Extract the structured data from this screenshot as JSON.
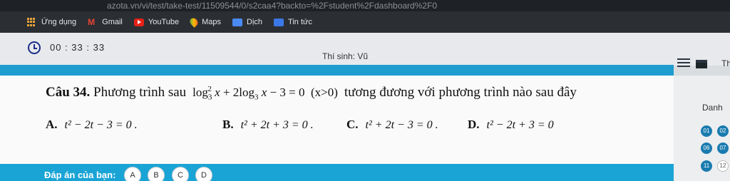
{
  "browser": {
    "url": "azota.vn/vi/test/take-test/11509544/0/s2caa4?backto=%2Fstudent%2Fdashboard%2F0",
    "bookmarks": [
      {
        "label": "Ứng dụng",
        "icon": "apps-icon"
      },
      {
        "label": "Gmail",
        "icon": "gmail-icon"
      },
      {
        "label": "YouTube",
        "icon": "youtube-icon"
      },
      {
        "label": "Maps",
        "icon": "maps-icon"
      },
      {
        "label": "Dịch",
        "icon": "translate-icon"
      },
      {
        "label": "Tin tức",
        "icon": "news-icon"
      }
    ]
  },
  "exam": {
    "timer": "00 : 33 : 33",
    "student": "Thí sinh: Vũ",
    "right_header": "Th"
  },
  "question": {
    "number": "Câu 34.",
    "prefix": "Phương trình sau",
    "suffix": "tương đương với phương trình nào sau đây",
    "answers": [
      {
        "letter": "A.",
        "text": "t² − 2t − 3 = 0 ."
      },
      {
        "letter": "B.",
        "text": "t² + 2t + 3 = 0 ."
      },
      {
        "letter": "C.",
        "text": "t² + 2t − 3 = 0 ."
      },
      {
        "letter": "D.",
        "text": "t² − 2t + 3 = 0"
      }
    ]
  },
  "answer_bar": {
    "label": "Đáp án của bạn:",
    "options": [
      "A",
      "B",
      "C",
      "D"
    ]
  },
  "side_panel": {
    "title": "Danh",
    "numbers": [
      {
        "n": "01",
        "state": "done"
      },
      {
        "n": "02",
        "state": "done"
      },
      {
        "n": "06",
        "state": "done"
      },
      {
        "n": "07",
        "state": "done"
      },
      {
        "n": "11",
        "state": "done"
      },
      {
        "n": "12",
        "state": "open"
      }
    ]
  },
  "colors": {
    "accent": "#1aa4d6",
    "stripe": "#1f9cd0",
    "done": "#1a7baf"
  }
}
